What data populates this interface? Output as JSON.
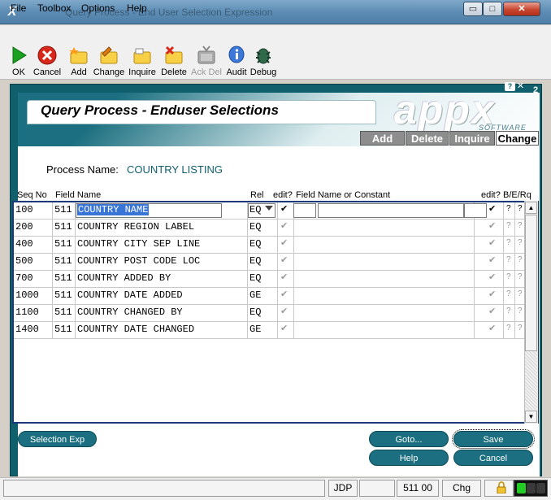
{
  "window": {
    "app_icon": "X",
    "title": "Query Process - End User Selection Expression",
    "minimize_glyph": "▭",
    "maximize_glyph": "□",
    "close_glyph": "✕"
  },
  "menu": {
    "file": "File",
    "toolbox": "Toolbox",
    "options": "Options",
    "help": "Help"
  },
  "toolbar": {
    "ok": "OK",
    "cancel": "Cancel",
    "add": "Add",
    "change": "Change",
    "inquire": "Inquire",
    "delete": "Delete",
    "ackdel": "Ack Del",
    "audit": "Audit",
    "debug": "Debug"
  },
  "frame": {
    "help_glyph": "?",
    "close_glyph": "✕",
    "number": "2"
  },
  "header": {
    "title": "Query Process - Enduser Selections",
    "logo": "appx",
    "logo_sub": "SOFTWARE"
  },
  "modes": {
    "add": "Add",
    "delete": "Delete",
    "inquire": "Inquire",
    "change": "Change",
    "active": "Change"
  },
  "process": {
    "label": "Process Name:",
    "value": "COUNTRY LISTING"
  },
  "columns": {
    "seq": "Seq No",
    "field": "Field Name",
    "rel": "Rel",
    "edit1": "edit?",
    "field_const": "Field Name or Constant",
    "edit2": "edit?",
    "ber": "B/E/Rq"
  },
  "rows": [
    {
      "seq": "100",
      "file": "511",
      "field": "COUNTRY NAME",
      "rel": "EQ",
      "chk1": "✔",
      "chk2": "✔",
      "q1": "?",
      "q2": "?"
    },
    {
      "seq": "200",
      "file": "511",
      "field": "COUNTRY REGION LABEL",
      "rel": "EQ",
      "chk1": "✔",
      "chk2": "✔",
      "q1": "?",
      "q2": "?"
    },
    {
      "seq": "400",
      "file": "511",
      "field": "COUNTRY CITY SEP LINE",
      "rel": "EQ",
      "chk1": "✔",
      "chk2": "✔",
      "q1": "?",
      "q2": "?"
    },
    {
      "seq": "500",
      "file": "511",
      "field": "COUNTRY POST CODE LOC",
      "rel": "EQ",
      "chk1": "✔",
      "chk2": "✔",
      "q1": "?",
      "q2": "?"
    },
    {
      "seq": "700",
      "file": "511",
      "field": "COUNTRY ADDED BY",
      "rel": "EQ",
      "chk1": "✔",
      "chk2": "✔",
      "q1": "?",
      "q2": "?"
    },
    {
      "seq": "1000",
      "file": "511",
      "field": "COUNTRY DATE ADDED",
      "rel": "GE",
      "chk1": "✔",
      "chk2": "✔",
      "q1": "?",
      "q2": "?"
    },
    {
      "seq": "1100",
      "file": "511",
      "field": "COUNTRY CHANGED BY",
      "rel": "EQ",
      "chk1": "✔",
      "chk2": "✔",
      "q1": "?",
      "q2": "?"
    },
    {
      "seq": "1400",
      "file": "511",
      "field": "COUNTRY DATE CHANGED",
      "rel": "GE",
      "chk1": "✔",
      "chk2": "✔",
      "q1": "?",
      "q2": "?"
    }
  ],
  "scroll": {
    "up_glyph": "▲",
    "down_glyph": "▼"
  },
  "buttons": {
    "selection_exp": "Selection Exp",
    "goto": "Goto...",
    "help": "Help",
    "save": "Save",
    "cancel": "Cancel"
  },
  "status": {
    "user": "JDP",
    "app": "511 00",
    "mode": "Chg"
  },
  "colors": {
    "teal": "#1b6f80",
    "frame": "#0f5f6d",
    "selection": "#3875d7",
    "light_green": "#22cc22",
    "light_dark": "#3a3a3a"
  }
}
